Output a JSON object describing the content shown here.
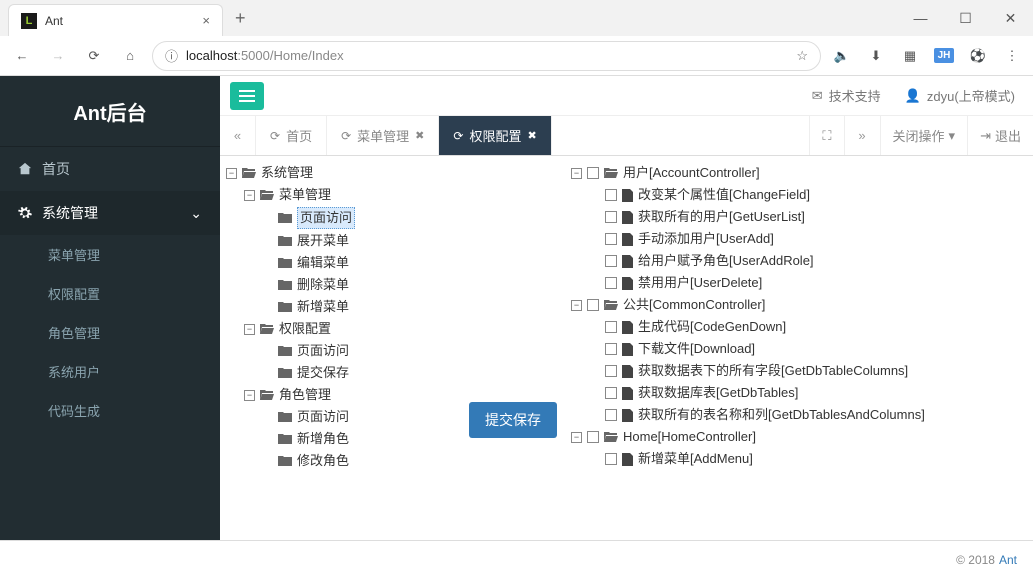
{
  "browser": {
    "tab_title": "Ant",
    "url_host": "localhost",
    "url_path": ":5000/Home/Index",
    "avatar": "JH"
  },
  "brand": "Ant后台",
  "sidebar": {
    "home": "首页",
    "sysmgmt": "系统管理",
    "subs": [
      "菜单管理",
      "权限配置",
      "角色管理",
      "系统用户",
      "代码生成"
    ]
  },
  "topbar": {
    "support": "技术支持",
    "user": "zdyu(上帝模式)"
  },
  "tabs": {
    "items": [
      {
        "label": "首页",
        "closable": false,
        "active": false
      },
      {
        "label": "菜单管理",
        "closable": true,
        "active": false
      },
      {
        "label": "权限配置",
        "closable": true,
        "active": true
      }
    ],
    "close_ops": "关闭操作",
    "logout": "退出"
  },
  "left_tree": [
    {
      "depth": 0,
      "toggle": "-",
      "icon": "folder-open",
      "label": "系统管理"
    },
    {
      "depth": 1,
      "toggle": "-",
      "icon": "folder-open",
      "label": "菜单管理"
    },
    {
      "depth": 2,
      "toggle": "",
      "icon": "folder",
      "label": "页面访问",
      "selected": true
    },
    {
      "depth": 2,
      "toggle": "",
      "icon": "folder",
      "label": "展开菜单"
    },
    {
      "depth": 2,
      "toggle": "",
      "icon": "folder",
      "label": "编辑菜单"
    },
    {
      "depth": 2,
      "toggle": "",
      "icon": "folder",
      "label": "删除菜单"
    },
    {
      "depth": 2,
      "toggle": "",
      "icon": "folder",
      "label": "新增菜单"
    },
    {
      "depth": 1,
      "toggle": "-",
      "icon": "folder-open",
      "label": "权限配置"
    },
    {
      "depth": 2,
      "toggle": "",
      "icon": "folder",
      "label": "页面访问"
    },
    {
      "depth": 2,
      "toggle": "",
      "icon": "folder",
      "label": "提交保存"
    },
    {
      "depth": 1,
      "toggle": "-",
      "icon": "folder-open",
      "label": "角色管理"
    },
    {
      "depth": 2,
      "toggle": "",
      "icon": "folder",
      "label": "页面访问"
    },
    {
      "depth": 2,
      "toggle": "",
      "icon": "folder",
      "label": "新增角色"
    },
    {
      "depth": 2,
      "toggle": "",
      "icon": "folder",
      "label": "修改角色"
    }
  ],
  "right_tree": [
    {
      "depth": 0,
      "toggle": "-",
      "cb": true,
      "icon": "folder-open",
      "label": "用户[AccountController]"
    },
    {
      "depth": 1,
      "toggle": "",
      "cb": true,
      "icon": "file",
      "label": "改变某个属性值[ChangeField]"
    },
    {
      "depth": 1,
      "toggle": "",
      "cb": true,
      "icon": "file",
      "label": "获取所有的用户[GetUserList]"
    },
    {
      "depth": 1,
      "toggle": "",
      "cb": true,
      "icon": "file",
      "label": "手动添加用户[UserAdd]"
    },
    {
      "depth": 1,
      "toggle": "",
      "cb": true,
      "icon": "file",
      "label": "给用户赋予角色[UserAddRole]"
    },
    {
      "depth": 1,
      "toggle": "",
      "cb": true,
      "icon": "file",
      "label": "禁用用户[UserDelete]"
    },
    {
      "depth": 0,
      "toggle": "-",
      "cb": true,
      "icon": "folder-open",
      "label": "公共[CommonController]"
    },
    {
      "depth": 1,
      "toggle": "",
      "cb": true,
      "icon": "file",
      "label": "生成代码[CodeGenDown]"
    },
    {
      "depth": 1,
      "toggle": "",
      "cb": true,
      "icon": "file",
      "label": "下载文件[Download]"
    },
    {
      "depth": 1,
      "toggle": "",
      "cb": true,
      "icon": "file",
      "label": "获取数据表下的所有字段[GetDbTableColumns]"
    },
    {
      "depth": 1,
      "toggle": "",
      "cb": true,
      "icon": "file",
      "label": "获取数据库表[GetDbTables]"
    },
    {
      "depth": 1,
      "toggle": "",
      "cb": true,
      "icon": "file",
      "label": "获取所有的表名称和列[GetDbTablesAndColumns]"
    },
    {
      "depth": 0,
      "toggle": "-",
      "cb": true,
      "icon": "folder-open",
      "label": "Home[HomeController]"
    },
    {
      "depth": 1,
      "toggle": "",
      "cb": true,
      "icon": "file",
      "label": "新增菜单[AddMenu]"
    }
  ],
  "submit": "提交保存",
  "footer": {
    "copy": "© 2018",
    "link": "Ant"
  }
}
